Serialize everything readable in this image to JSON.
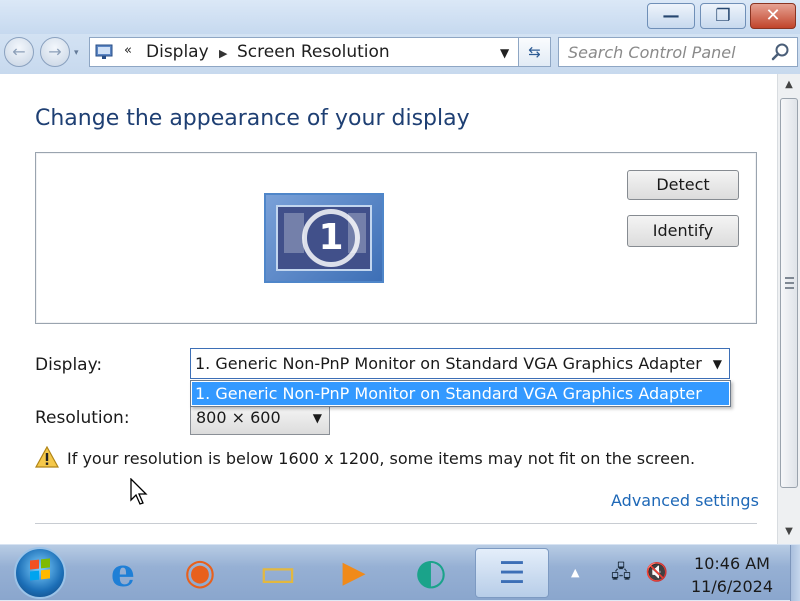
{
  "window": {
    "minimize_glyph": "—",
    "maximize_glyph": "❐",
    "close_glyph": "✕"
  },
  "nav": {
    "back_glyph": "←",
    "forward_glyph": "→",
    "history_glyph": "▾"
  },
  "address": {
    "overflow_glyph": "«",
    "breadcrumbs": [
      "Display",
      "Screen Resolution"
    ],
    "separator_glyph": "▶",
    "dropdown_glyph": "▼",
    "refresh_glyph": "⇆"
  },
  "search": {
    "placeholder": "Search Control Panel",
    "icon": "search-icon"
  },
  "main": {
    "title": "Change the appearance of your display",
    "monitor_number": "1",
    "detect_label": "Detect",
    "identify_label": "Identify",
    "display_label": "Display:",
    "display_value": "1. Generic Non-PnP Monitor on Standard VGA Graphics Adapter",
    "display_options": [
      "1. Generic Non-PnP Monitor on Standard VGA Graphics Adapter"
    ],
    "resolution_label": "Resolution:",
    "resolution_value": "800 × 600",
    "warning_text": "If your resolution is below 1600 x 1200, some items may not fit on the screen.",
    "advanced_link": "Advanced settings",
    "dropdown_glyph": "▼"
  },
  "taskbar": {
    "apps": [
      {
        "name": "internet-explorer",
        "glyph": "e",
        "color": "#1f7fd6"
      },
      {
        "name": "firefox",
        "glyph": "◉",
        "color": "#e8601c"
      },
      {
        "name": "windows-explorer",
        "glyph": "▭",
        "color": "#e3b840"
      },
      {
        "name": "media-player",
        "glyph": "▶",
        "color": "#f08a1a"
      },
      {
        "name": "photo-app",
        "glyph": "◐",
        "color": "#1aa38a"
      },
      {
        "name": "control-panel",
        "glyph": "☰",
        "color": "#3d6fb6"
      }
    ],
    "tray_arrow": "▲",
    "network_glyph": "🖧",
    "volume_glyph": "🔇",
    "time": "10:46 AM",
    "date": "11/6/2024"
  },
  "colors": {
    "accent": "#1e3f73",
    "link": "#1e68b7",
    "selection": "#3399ff",
    "close_button": "#c1442b"
  }
}
